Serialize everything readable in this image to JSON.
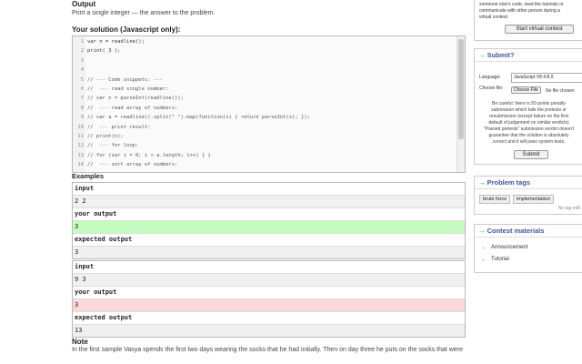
{
  "output_heading": "Output",
  "output_text": "Print a single integer — the answer to the problem.",
  "solution_heading": "Your solution (Javascript only):",
  "code_lines": [
    {
      "n": "1",
      "t": "var n = readline();"
    },
    {
      "n": "2",
      "t": "print( 3 );"
    },
    {
      "n": "3",
      "t": ""
    },
    {
      "n": "4",
      "t": ""
    },
    {
      "n": "5",
      "t": "// --- Code snippets: ---"
    },
    {
      "n": "6",
      "t": "//  --- read single number:"
    },
    {
      "n": "7",
      "t": "// var n = parseInt(readline());"
    },
    {
      "n": "8",
      "t": "//  --- read array of numbers:"
    },
    {
      "n": "9",
      "t": "// var a = readline().split(\" \").map(function(x) { return parseInt(x); });"
    },
    {
      "n": "10",
      "t": "//  --- print result:"
    },
    {
      "n": "11",
      "t": "// print(n);"
    },
    {
      "n": "12",
      "t": "//  --- for loop:"
    },
    {
      "n": "13",
      "t": "// for (var i = 0; i < a.length; i++) { }"
    },
    {
      "n": "14",
      "t": "//  --- sort array of numbers:"
    }
  ],
  "examples_heading": "Examples",
  "examples": [
    {
      "input_label": "input",
      "input": "2 2",
      "your_label": "your output",
      "your": "3",
      "expected_label": "expected output",
      "expected": "3",
      "status": "ok"
    },
    {
      "input_label": "input",
      "input": "9 3",
      "your_label": "your output",
      "your": "3",
      "expected_label": "expected output",
      "expected": "13",
      "status": "bad"
    }
  ],
  "note_heading": "Note",
  "note_text": "In the first sample Vasya spends the first two days wearing the socks that he had initially. Then on day three he puts on the socks that were",
  "virtual": {
    "text_lines": [
      "someone else's code, read the tutorials or",
      "communicate with other person during a",
      "virtual contest."
    ],
    "button": "Start virtual contest"
  },
  "submit": {
    "title": "→ Submit?",
    "language_label": "Language:",
    "language_value": "JavaScript V8 4.8.0",
    "choose_label": "Choose file:",
    "choose_button": "Choose File",
    "no_file": "No file chosen",
    "warning_lines": [
      "Be careful: there is 50 points penalty",
      "submission which fails the pretests or",
      "resubmission (except failure on the first",
      "default of judgement on similar verdicts)",
      "\"Passed pretests\" submission verdict doesn't",
      "guarantee that the solution is absolutely",
      "correct and it will pass system tests."
    ],
    "button": "Submit"
  },
  "tags": {
    "title": "→ Problem tags",
    "items": [
      "brute force",
      "implementation"
    ],
    "no_tag_edit": "No tag edit"
  },
  "materials": {
    "title": "→ Contest materials",
    "items": [
      "Announcement",
      "Tutorial"
    ]
  }
}
